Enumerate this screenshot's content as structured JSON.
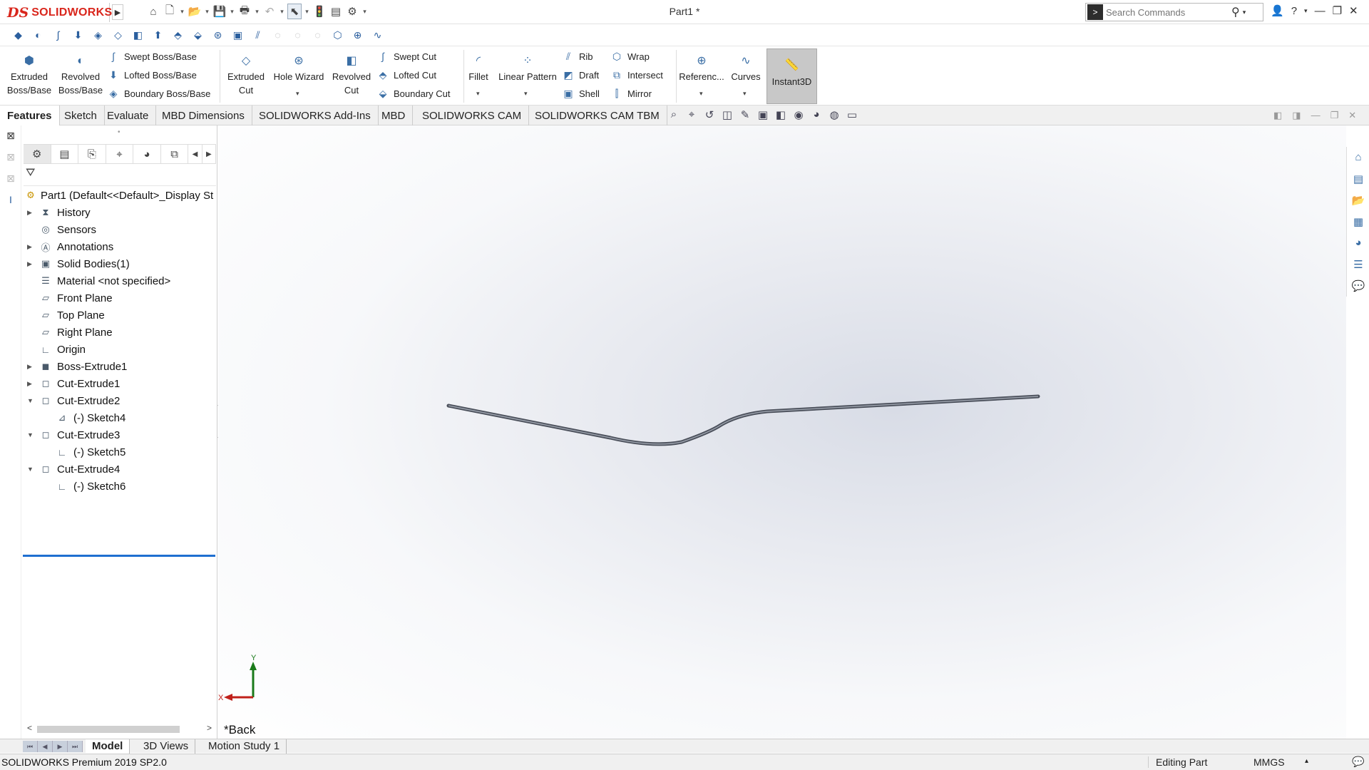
{
  "app": {
    "logo_prefix": "DS",
    "logo_text": "SOLIDWORKS",
    "document_title": "Part1 *"
  },
  "search": {
    "placeholder": "Search Commands"
  },
  "command_manager": {
    "extruded_boss": "Extruded Boss/Base",
    "revolved_boss": "Revolved Boss/Base",
    "swept_boss": "Swept Boss/Base",
    "lofted_boss": "Lofted Boss/Base",
    "boundary_boss": "Boundary Boss/Base",
    "extruded_cut": "Extruded Cut",
    "hole_wizard": "Hole Wizard",
    "revolved_cut": "Revolved Cut",
    "swept_cut": "Swept Cut",
    "lofted_cut": "Lofted Cut",
    "boundary_cut": "Boundary Cut",
    "fillet": "Fillet",
    "linear_pattern": "Linear Pattern",
    "rib": "Rib",
    "draft": "Draft",
    "shell": "Shell",
    "wrap": "Wrap",
    "intersect": "Intersect",
    "mirror": "Mirror",
    "reference": "Referenc...",
    "curves": "Curves",
    "instant3d": "Instant3D"
  },
  "tabs": [
    "Features",
    "Sketch",
    "Evaluate",
    "MBD Dimensions",
    "SOLIDWORKS Add-Ins",
    "MBD",
    "SOLIDWORKS CAM",
    "SOLIDWORKS CAM TBM"
  ],
  "feature_tree": {
    "root": "Part1  (Default<<Default>_Display St",
    "items": [
      {
        "label": "History",
        "icon": "history-icon",
        "expandable": true
      },
      {
        "label": "Sensors",
        "icon": "sensors-icon",
        "expandable": false
      },
      {
        "label": "Annotations",
        "icon": "annotations-icon",
        "expandable": true
      },
      {
        "label": "Solid Bodies(1)",
        "icon": "solid-bodies-icon",
        "expandable": true
      },
      {
        "label": "Material <not specified>",
        "icon": "material-icon",
        "expandable": false
      },
      {
        "label": "Front Plane",
        "icon": "plane-icon",
        "expandable": false
      },
      {
        "label": "Top Plane",
        "icon": "plane-icon",
        "expandable": false
      },
      {
        "label": "Right Plane",
        "icon": "plane-icon",
        "expandable": false
      },
      {
        "label": "Origin",
        "icon": "origin-icon",
        "expandable": false
      },
      {
        "label": "Boss-Extrude1",
        "icon": "boss-extrude-icon",
        "expandable": true
      },
      {
        "label": "Cut-Extrude1",
        "icon": "cut-extrude-icon",
        "expandable": true
      },
      {
        "label": "Cut-Extrude2",
        "icon": "cut-extrude-icon",
        "expanded": true
      },
      {
        "label": "(-) Sketch4",
        "icon": "sketch-icon",
        "child": true
      },
      {
        "label": "Cut-Extrude3",
        "icon": "cut-extrude-icon",
        "expanded": true
      },
      {
        "label": "(-) Sketch5",
        "icon": "sketch-icon",
        "child": true
      },
      {
        "label": "Cut-Extrude4",
        "icon": "cut-extrude-icon",
        "expanded": true
      },
      {
        "label": "(-) Sketch6",
        "icon": "sketch-icon",
        "child": true
      }
    ]
  },
  "viewport": {
    "view_name": "*Back",
    "triad_y": "Y",
    "triad_x": "X"
  },
  "bottom_tabs": [
    "Model",
    "3D Views",
    "Motion Study 1"
  ],
  "status": {
    "version": "SOLIDWORKS Premium 2019 SP2.0",
    "mode": "Editing Part",
    "units": "MMGS"
  },
  "colors": {
    "brand_red": "#d9261c",
    "accent_blue": "#1f6fd0",
    "part_edge": "#4a4f5a"
  }
}
